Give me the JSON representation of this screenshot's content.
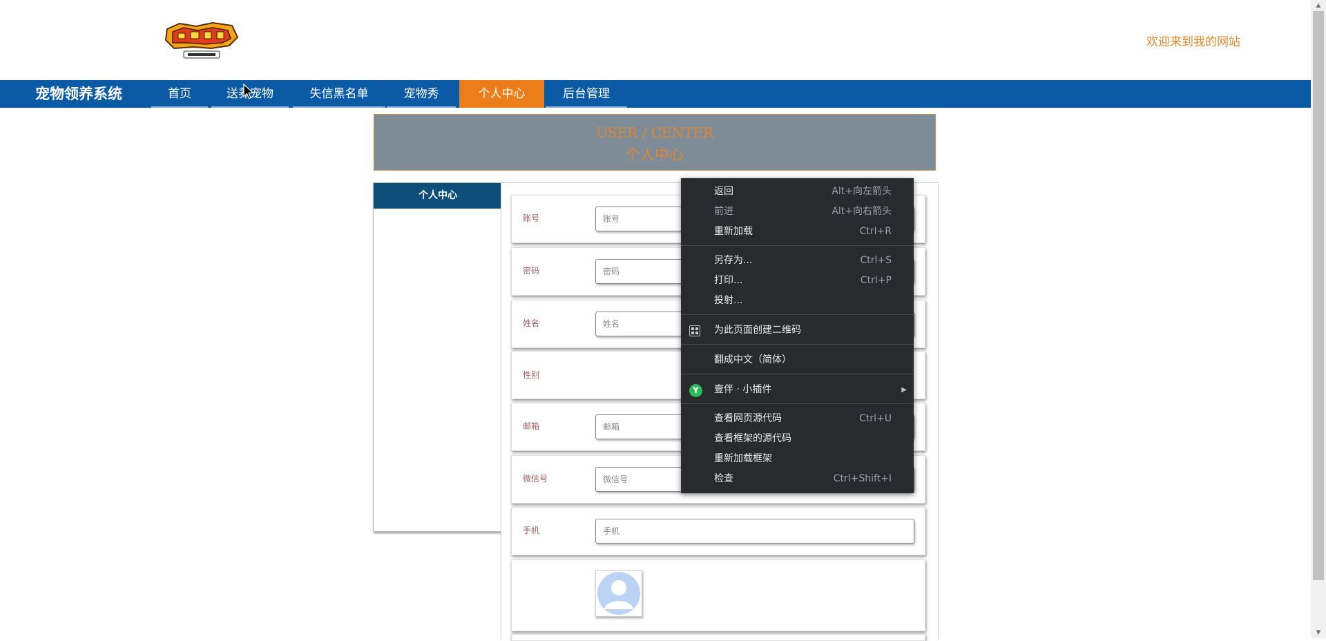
{
  "header": {
    "logo_text": "DIGIMON ADVENTURE BIGBYOS",
    "welcome": "欢迎来到我的网站"
  },
  "nav": {
    "brand": "宠物领养系统",
    "items": [
      {
        "label": "首页"
      },
      {
        "label": "送养宠物"
      },
      {
        "label": "失信黑名单"
      },
      {
        "label": "宠物秀"
      },
      {
        "label": "个人中心"
      },
      {
        "label": "后台管理"
      }
    ],
    "active": "个人中心"
  },
  "banner": {
    "en": "USER / CENTER",
    "zh": "个人中心"
  },
  "side": {
    "title": "个人中心"
  },
  "form": {
    "fields": [
      {
        "label": "账号",
        "placeholder": "账号"
      },
      {
        "label": "密码",
        "placeholder": "密码"
      },
      {
        "label": "姓名",
        "placeholder": "姓名"
      },
      {
        "label": "性别",
        "placeholder": ""
      },
      {
        "label": "邮箱",
        "placeholder": "邮箱"
      },
      {
        "label": "微信号",
        "placeholder": "微信号"
      },
      {
        "label": "手机",
        "placeholder": "手机"
      }
    ]
  },
  "context_menu": {
    "items": [
      {
        "label": "返回",
        "shortcut": "Alt+向左箭头"
      },
      {
        "label": "前进",
        "shortcut": "Alt+向右箭头"
      },
      {
        "label": "重新加载",
        "shortcut": "Ctrl+R"
      },
      {
        "label": "另存为...",
        "shortcut": "Ctrl+S"
      },
      {
        "label": "打印...",
        "shortcut": "Ctrl+P"
      },
      {
        "label": "投射...",
        "shortcut": ""
      },
      {
        "label": "为此页面创建二维码",
        "shortcut": ""
      },
      {
        "label": "翻成中文（简体）",
        "shortcut": ""
      },
      {
        "label": "壹伴 · 小插件",
        "shortcut": ""
      },
      {
        "label": "查看网页源代码",
        "shortcut": "Ctrl+U"
      },
      {
        "label": "查看框架的源代码",
        "shortcut": ""
      },
      {
        "label": "重新加载框架",
        "shortcut": ""
      },
      {
        "label": "检查",
        "shortcut": "Ctrl+Shift+I"
      }
    ],
    "icons": {
      "qr": "qr-code-icon",
      "plugin": "yiban-plugin-icon",
      "plugin_letter": "Y",
      "submenu": "submenu-arrow-icon"
    }
  },
  "colors": {
    "nav_bg": "#0a5aa6",
    "active_bg": "#ec7d18",
    "accent": "#e6862a",
    "banner_bg": "#7e8c98",
    "side_head_bg": "#0d4f79",
    "menu_bg": "#292a2d"
  }
}
